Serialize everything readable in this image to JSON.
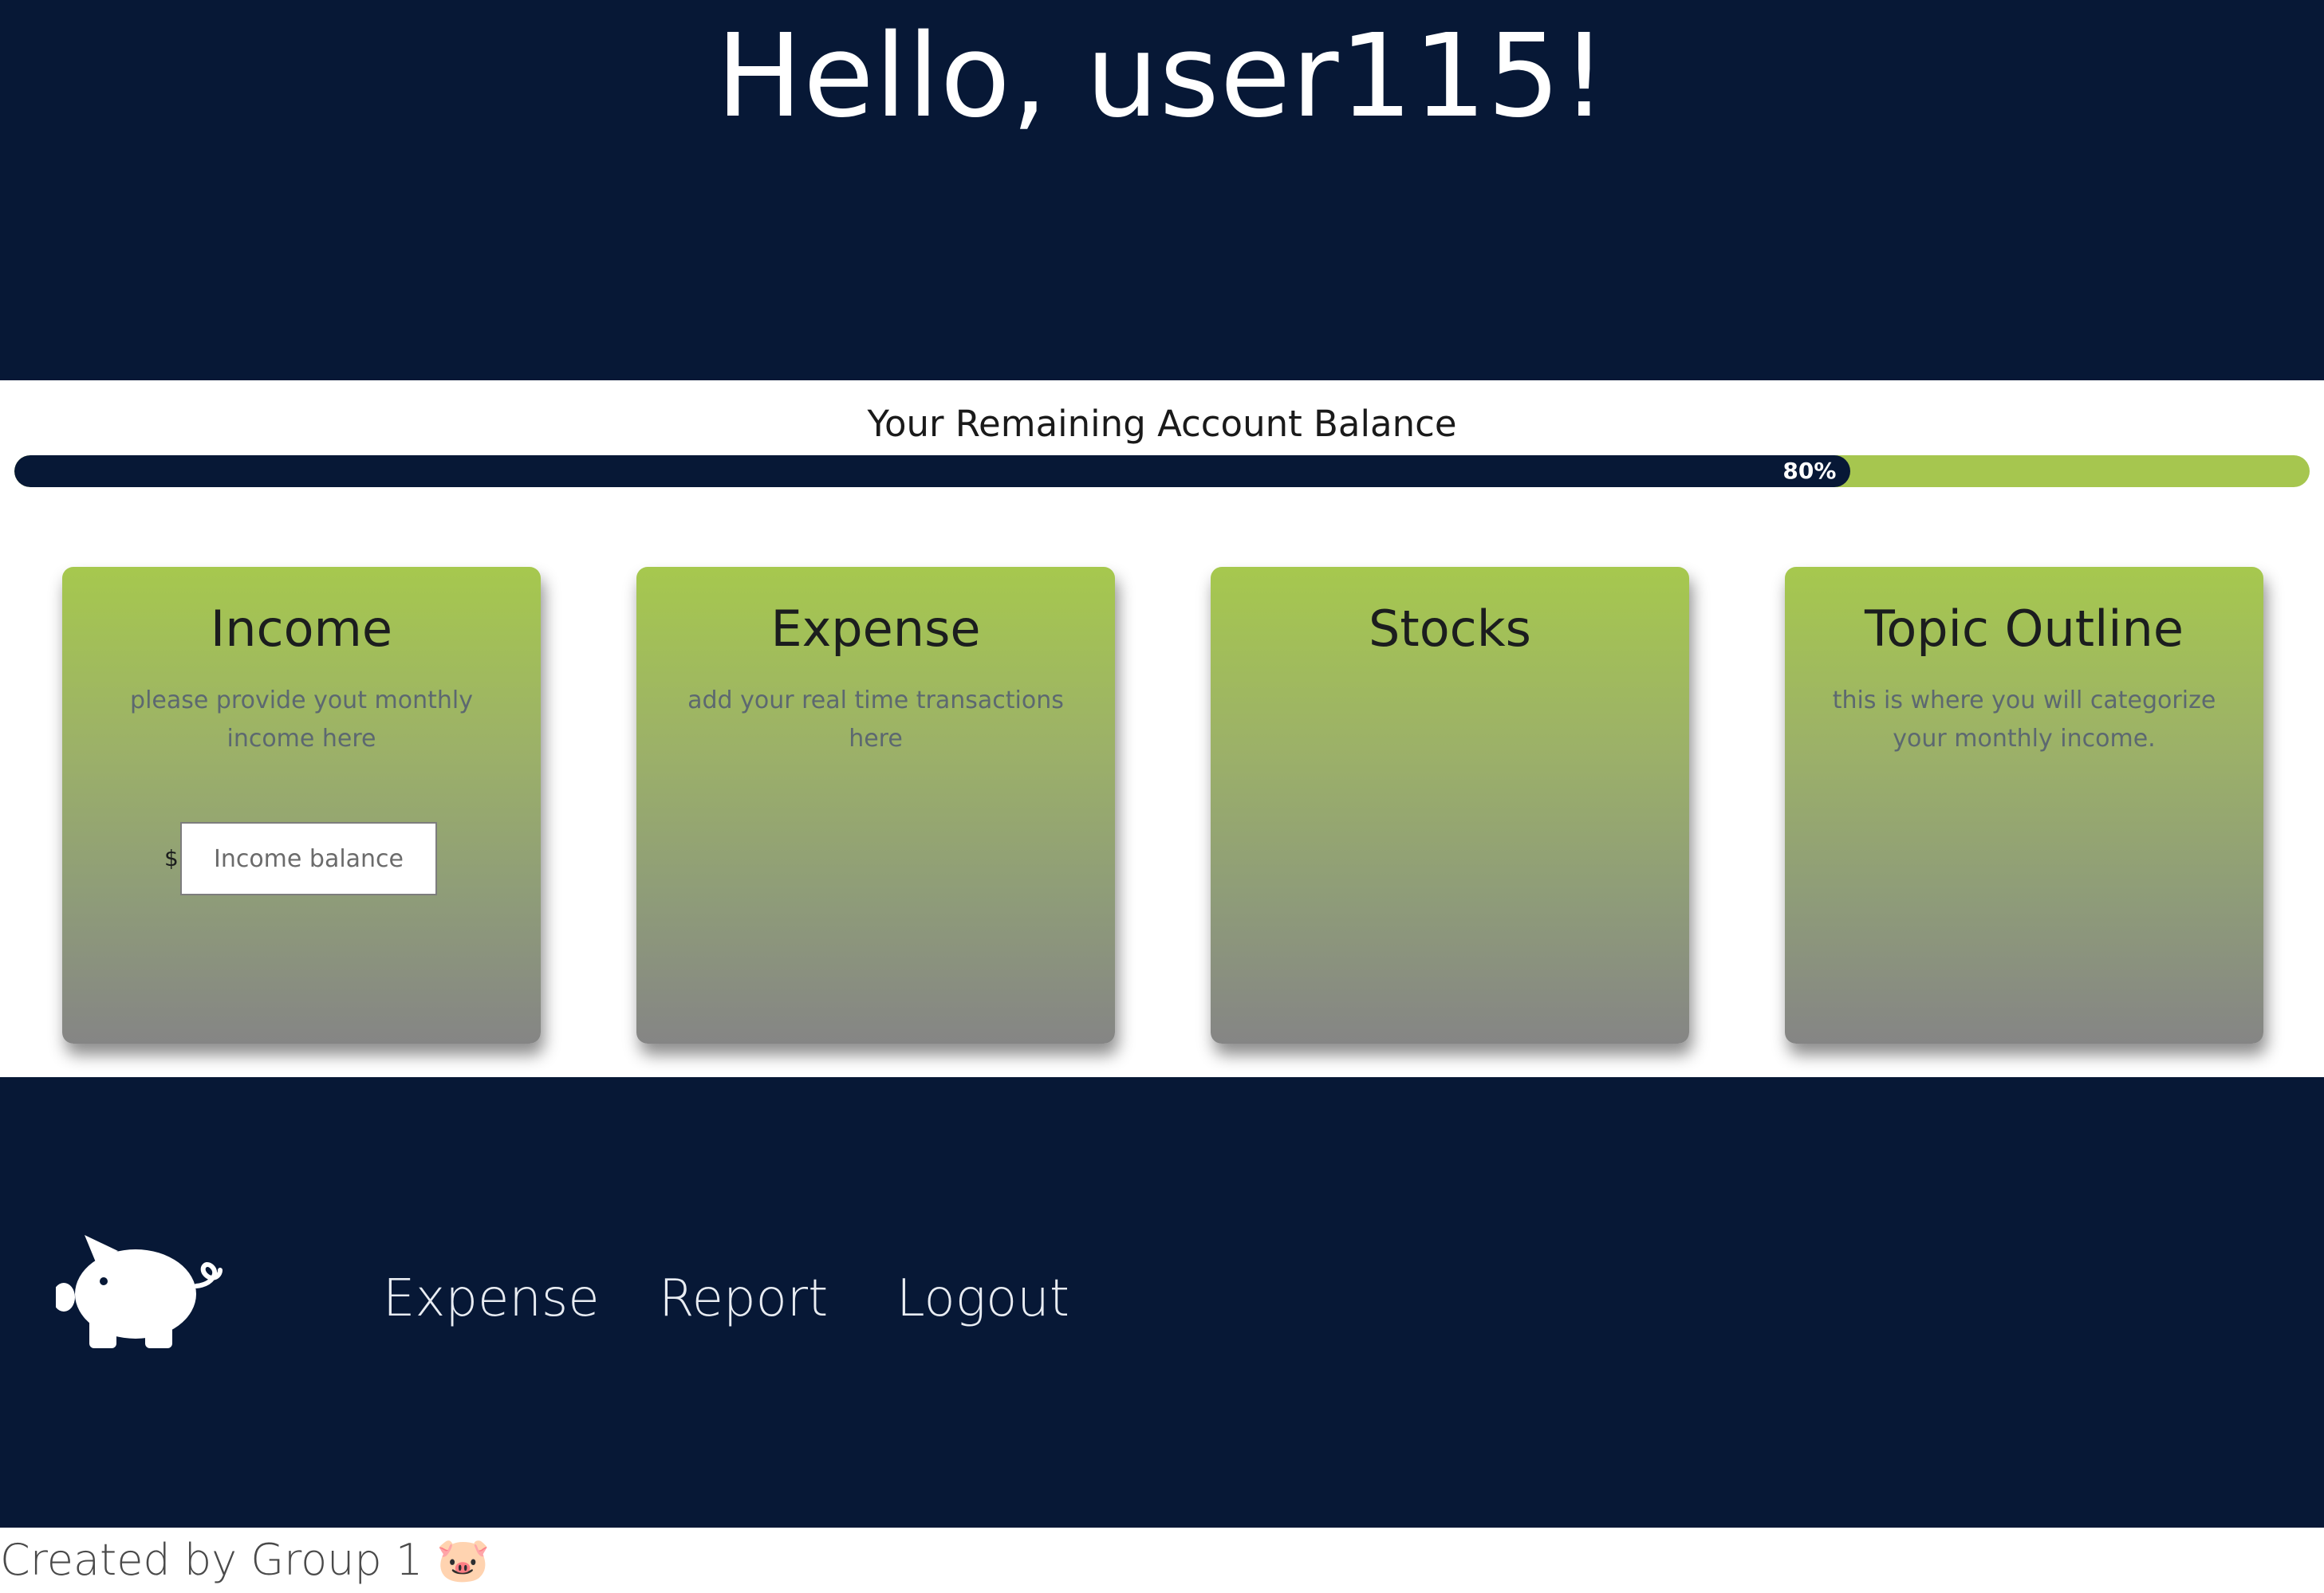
{
  "header": {
    "greeting": "Hello, user115!"
  },
  "balance": {
    "title": "Your Remaining Account Balance",
    "percent": 80,
    "percent_label": "80%"
  },
  "cards": [
    {
      "title": "Income",
      "description": "please provide yout monthly income here"
    },
    {
      "title": "Expense",
      "description": "add your real time transactions here"
    },
    {
      "title": "Stocks",
      "description": ""
    },
    {
      "title": "Topic Outline",
      "description": "this is where you will categorize your monthly income."
    }
  ],
  "income_form": {
    "currency_symbol": "$",
    "placeholder": "Income balance",
    "value": ""
  },
  "footer": {
    "logo_icon": "piggy-bank-icon",
    "nav": [
      {
        "label": "Expense"
      },
      {
        "label": "Report"
      },
      {
        "label": "Logout"
      }
    ],
    "credit": "Created by Group 1 🐷"
  },
  "colors": {
    "navy": "#071836",
    "accent_green": "#a6c64f",
    "card_bottom_grey": "#858585"
  }
}
